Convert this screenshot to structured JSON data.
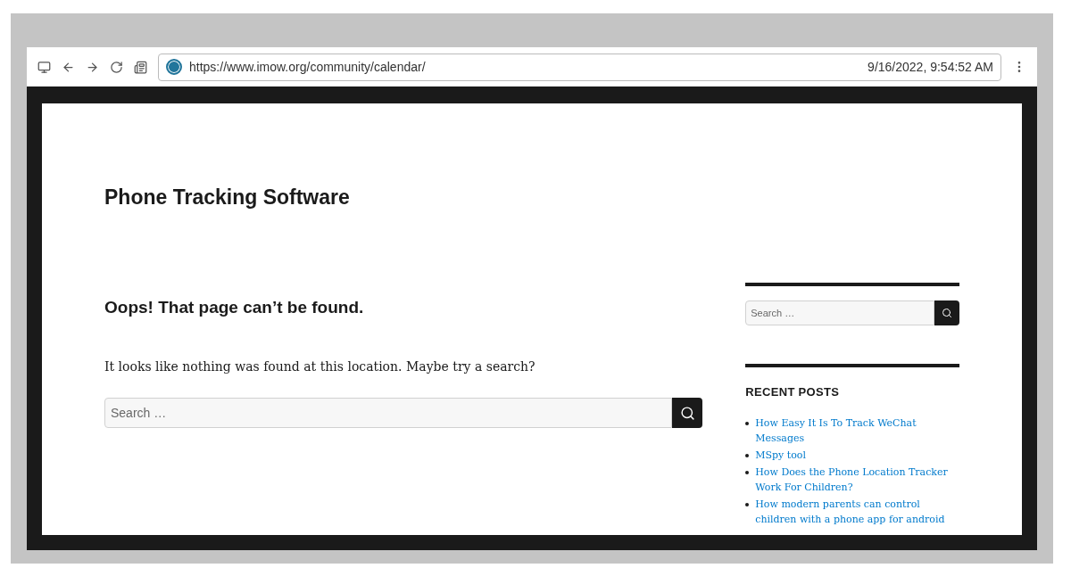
{
  "browser": {
    "url": "https://www.imow.org/community/calendar/",
    "timestamp": "9/16/2022, 9:54:52 AM"
  },
  "site": {
    "title": "Phone Tracking Software"
  },
  "main": {
    "heading": "Oops! That page can’t be found.",
    "message": "It looks like nothing was found at this location. Maybe try a search?",
    "search": {
      "placeholder": "Search …"
    }
  },
  "sidebar": {
    "search": {
      "placeholder": "Search …"
    },
    "recent_posts": {
      "heading": "RECENT POSTS",
      "items": [
        {
          "label": "How Easy It Is To Track WeChat Messages"
        },
        {
          "label": "MSpy tool"
        },
        {
          "label": "How Does the Phone Location Tracker Work For Children?"
        },
        {
          "label": "How modern parents can control children with a phone app for android"
        }
      ]
    }
  }
}
